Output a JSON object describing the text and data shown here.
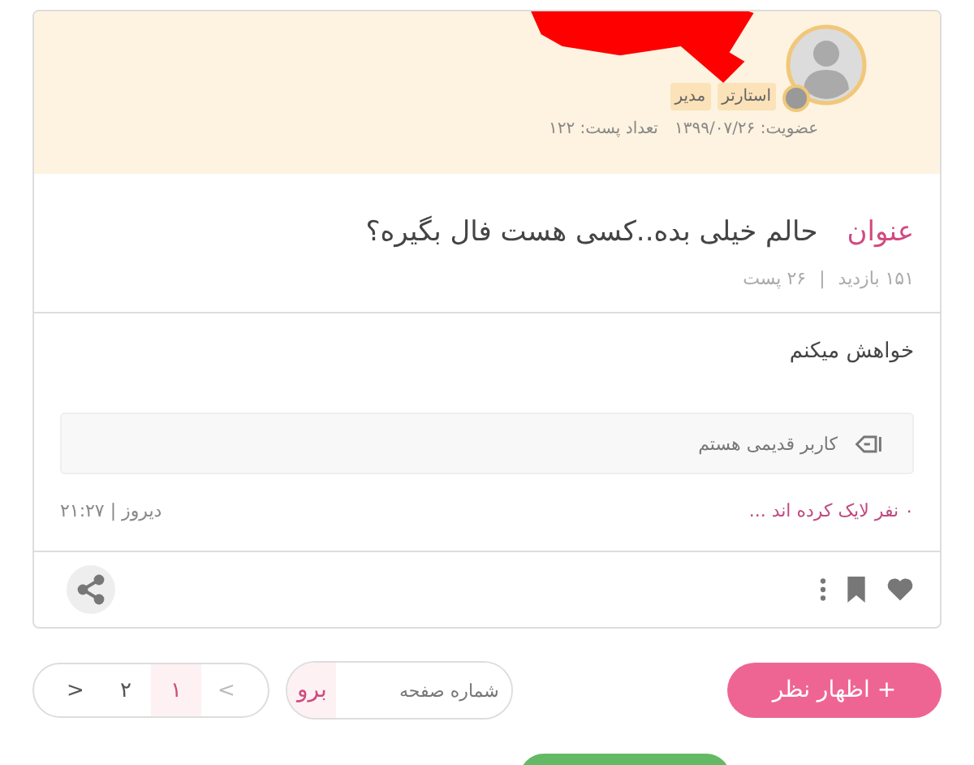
{
  "author": {
    "badges": [
      "استارتر",
      "مدیر"
    ],
    "online": false,
    "membership": "عضویت: ۱۳۹۹/۰۷/۲۶",
    "post_count": "تعداد پست: ۱۲۲"
  },
  "topic": {
    "label": "عنوان",
    "title": "حالم خیلی بده..کسی هست فال بگیره؟",
    "views": "۱۵۱ بازدید",
    "separator": "|",
    "posts": "۲۶ پست"
  },
  "post": {
    "body": "خواهش میکنم",
    "signature": "کاربر قدیمی هستم",
    "likes": "۰ نفر لایک کرده اند ...",
    "date": "دیروز | ۲۱:۲۷"
  },
  "pager": [
    {
      "label": "<",
      "selected": false,
      "disabled": true
    },
    {
      "label": "۱",
      "selected": true,
      "disabled": false
    },
    {
      "label": "۲",
      "selected": false,
      "disabled": false
    },
    {
      "label": ">",
      "selected": false,
      "disabled": false
    }
  ],
  "page_field": {
    "placeholder": "شماره صفحه",
    "go": "برو"
  },
  "reply_button": {
    "icon": "+",
    "label": "اظهار نظر"
  }
}
